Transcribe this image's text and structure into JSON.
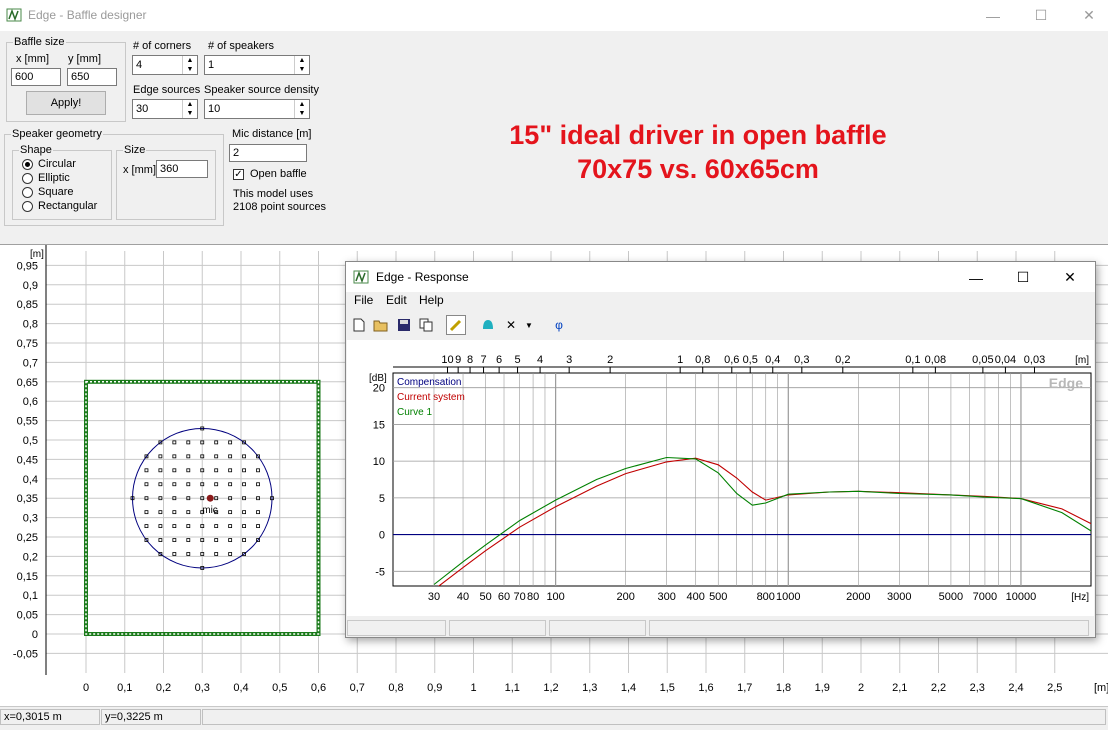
{
  "window": {
    "title": "Edge - Baffle designer",
    "icon": "edge-app-icon"
  },
  "baffle_size": {
    "legend": "Baffle size",
    "x_label": "x [mm]",
    "y_label": "y [mm]",
    "x_value": "600",
    "y_value": "650",
    "apply_label": "Apply!"
  },
  "corners": {
    "label": "# of corners",
    "value": "4"
  },
  "speakers": {
    "label": "# of speakers",
    "value": "1"
  },
  "edge_sources": {
    "label": "Edge sources",
    "value": "30"
  },
  "source_density": {
    "label": "Speaker source density",
    "value": "10"
  },
  "speaker_geometry": {
    "legend": "Speaker geometry",
    "shape_legend": "Shape",
    "shapes": [
      "Circular",
      "Elliptic",
      "Square",
      "Rectangular"
    ],
    "selected_shape": "Circular",
    "size_legend": "Size",
    "size_x_label": "x [mm]",
    "size_x_value": "360"
  },
  "mic": {
    "distance_label": "Mic distance [m]",
    "distance_value": "2",
    "open_baffle_label": "Open baffle",
    "open_baffle_checked": true,
    "model_info_line1": "This model uses",
    "model_info_line2": "2108 point sources"
  },
  "headline": {
    "line1": "15\" ideal driver in open baffle",
    "line2": "70x75 vs. 60x65cm"
  },
  "baffle_plot": {
    "y_unit": "[m]",
    "x_unit": "[m]",
    "y_ticks": [
      "0,95",
      "0,9",
      "0,85",
      "0,8",
      "0,75",
      "0,7",
      "0,65",
      "0,6",
      "0,55",
      "0,5",
      "0,45",
      "0,4",
      "0,35",
      "0,3",
      "0,25",
      "0,2",
      "0,15",
      "0,1",
      "0,05",
      "0",
      "-0,05"
    ],
    "x_ticks": [
      "0",
      "0,1",
      "0,2",
      "0,3",
      "0,4",
      "0,5",
      "0,6",
      "0,7",
      "0,8",
      "0,9",
      "1",
      "1,1",
      "1,2",
      "1,3",
      "1,4",
      "1,5",
      "1,6",
      "1,7",
      "1,8",
      "1,9",
      "2",
      "2,1",
      "2,2",
      "2,3",
      "2,4",
      "2,5"
    ],
    "mic_label": "mic",
    "baffle_color": "#1a7a1a",
    "speaker_color": "#00007f"
  },
  "status": {
    "x": "x=0,3015 m",
    "y": "y=0,3225 m"
  },
  "response": {
    "title": "Edge - Response",
    "menu": [
      "File",
      "Edit",
      "Help"
    ],
    "toolbar": [
      "new-icon",
      "open-icon",
      "save-icon",
      "copy-icon",
      "pen-icon",
      "bell-icon",
      "delete-icon",
      "dropdown-arrow-icon",
      "phase-icon"
    ],
    "phi": "φ",
    "watermark": "Edge",
    "chart_data": {
      "type": "line",
      "ylabel": "[dB]",
      "xlabel": "[Hz]",
      "top_axis_unit": "[m]",
      "top_axis_ticks": [
        "10",
        "9",
        "8",
        "7",
        "6",
        "5",
        "4",
        "3",
        "2",
        "1",
        "0,8",
        "0,6",
        "0,5",
        "0,4",
        "0,3",
        "0,2",
        "0,1",
        "0,08",
        "0,05",
        "0,04",
        "0,03"
      ],
      "x_tick_labels": [
        "30",
        "40",
        "50",
        "60",
        "70",
        "80",
        "100",
        "200",
        "300",
        "400",
        "500",
        "800",
        "1000",
        "2000",
        "3000",
        "5000",
        "7000",
        "10000"
      ],
      "y_ticks": [
        20,
        15,
        10,
        5,
        0,
        -5
      ],
      "xlim": [
        20,
        20000
      ],
      "ylim": [
        -7,
        22
      ],
      "log_x": true,
      "legend": [
        "Compensation",
        "Current system",
        "Curve 1"
      ],
      "series": [
        {
          "name": "Compensation",
          "color": "#000080",
          "x": [
            20,
            20000
          ],
          "y": [
            0,
            0
          ]
        },
        {
          "name": "Current system",
          "color": "#c00000",
          "x": [
            30,
            40,
            50,
            70,
            100,
            150,
            200,
            300,
            400,
            500,
            600,
            700,
            800,
            1000,
            1500,
            2000,
            3000,
            5000,
            7000,
            10000,
            15000,
            20000
          ],
          "y": [
            -7.5,
            -4.5,
            -2.2,
            1.0,
            3.8,
            6.6,
            8.3,
            9.9,
            10.4,
            9.5,
            7.7,
            5.8,
            4.7,
            5.4,
            5.8,
            5.9,
            5.7,
            5.4,
            5.2,
            4.9,
            3.5,
            1.5
          ]
        },
        {
          "name": "Curve 1",
          "color": "#008000",
          "x": [
            30,
            40,
            50,
            70,
            100,
            150,
            200,
            300,
            400,
            500,
            600,
            700,
            800,
            1000,
            1500,
            2000,
            3000,
            5000,
            7000,
            10000,
            15000,
            20000
          ],
          "y": [
            -6.8,
            -3.7,
            -1.4,
            1.9,
            4.7,
            7.5,
            9.0,
            10.5,
            10.3,
            8.4,
            5.6,
            4.0,
            4.3,
            5.5,
            5.8,
            5.9,
            5.6,
            5.4,
            5.1,
            4.9,
            3.0,
            0.5
          ]
        }
      ]
    }
  }
}
